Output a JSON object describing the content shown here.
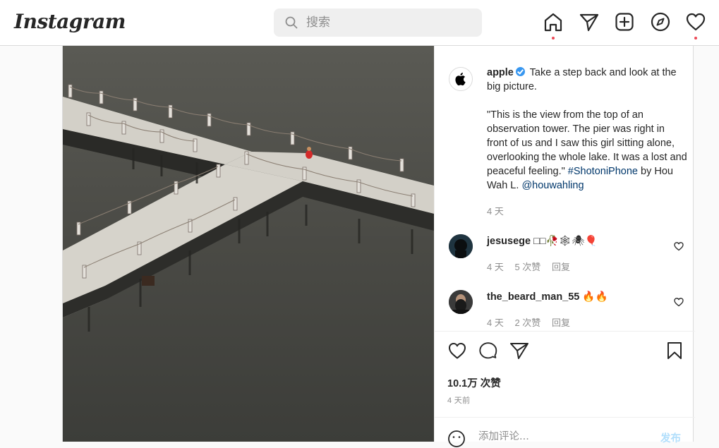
{
  "header": {
    "logo": "Instagram",
    "search_placeholder": "搜索"
  },
  "nav": {
    "home": "home-icon",
    "direct": "paper-plane-icon",
    "new_post": "plus-square-icon",
    "explore": "compass-icon",
    "activity": "heart-icon",
    "notification_dot_color": "#ed4956"
  },
  "post": {
    "author": "apple",
    "caption_lead": "Take a step back and look at the big picture.",
    "caption_body": "\"This is the view from the top of an observation tower. The pier was right in front of us and I saw this girl sitting alone, overlooking the whole lake. It was a lost and peaceful feeling.\"",
    "hashtag": "#ShotoniPhone",
    "by": "by Hou Wah L.",
    "mention": "@houwahling",
    "caption_time": "4 天",
    "likes": "10.1万 次赞",
    "posted": "4 天前"
  },
  "comments": [
    {
      "username": "jesusege",
      "text": "□□🥀🕸🕷🎈",
      "time": "4 天",
      "likes": "5 次赞",
      "reply": "回复"
    },
    {
      "username": "the_beard_man_55",
      "text": "🔥🔥",
      "time": "4 天",
      "likes": "2 次赞",
      "reply": "回复"
    }
  ],
  "add_comment": {
    "placeholder": "添加评论...",
    "submit": "发布"
  },
  "colors": {
    "link": "#00376b",
    "verified": "#3897f0",
    "post_button_disabled": "#b2dffc"
  }
}
